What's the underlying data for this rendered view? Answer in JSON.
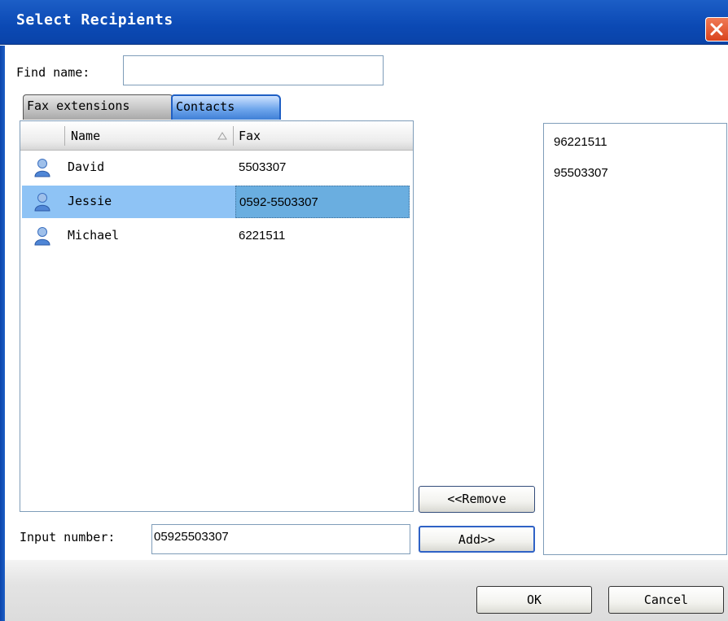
{
  "window": {
    "title": "Select Recipients"
  },
  "find": {
    "label": "Find name:",
    "value": ""
  },
  "tabs": [
    {
      "label": "Fax extensions",
      "active": false
    },
    {
      "label": "Contacts",
      "active": true
    }
  ],
  "contacts_table": {
    "columns": [
      "Name",
      "Fax"
    ],
    "sorted_column": "Name",
    "rows": [
      {
        "name": "David",
        "fax": "5503307",
        "selected": false
      },
      {
        "name": "Jessie",
        "fax": "0592-5503307",
        "selected": true
      },
      {
        "name": "Michael",
        "fax": "6221511",
        "selected": false
      }
    ]
  },
  "buttons": {
    "remove": "<<Remove",
    "add": "Add>>",
    "ok": "OK",
    "cancel": "Cancel"
  },
  "input_number": {
    "label": "Input number:",
    "value": "05925503307"
  },
  "recipients": [
    "96221511",
    "95503307"
  ],
  "colors": {
    "titlebar": "#0b49b4",
    "selection": "#8ec3f5",
    "active_tab": "#6fa6ec",
    "close": "#d9431d"
  }
}
